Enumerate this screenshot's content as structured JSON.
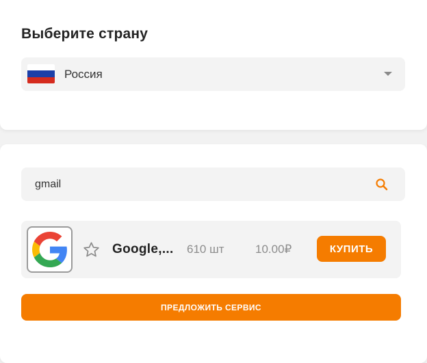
{
  "country_section": {
    "title": "Выберите страну",
    "selected_country": "Россия",
    "flag_colors": [
      "#ffffff",
      "#1c3fa8",
      "#d52b1e"
    ]
  },
  "search": {
    "value": "gmail",
    "placeholder": ""
  },
  "services": [
    {
      "name": "Google,...",
      "quantity": "610 шт",
      "price": "10.00₽",
      "buy_label": "КУПИТЬ",
      "icon": "google-icon"
    }
  ],
  "suggest_label": "ПРЕДЛОЖИТЬ СЕРВИС",
  "colors": {
    "accent": "#f57c00",
    "field_bg": "#f3f3f3"
  }
}
